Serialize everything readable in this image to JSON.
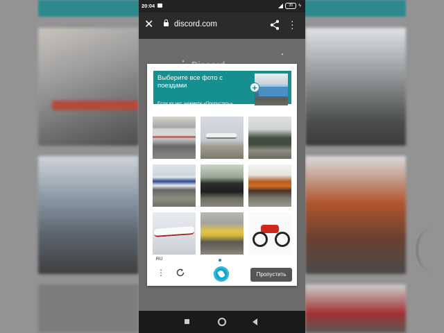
{
  "status_bar": {
    "time": "20:04",
    "battery": "35"
  },
  "browser": {
    "url": "discord.com"
  },
  "page": {
    "logo_text": "Discord"
  },
  "captcha": {
    "prompt_title": "Выберите все фото с поездами",
    "prompt_subtitle": "Если их нет, нажмите «Пропустить»",
    "accent_color": "#168f91",
    "tiles": [
      {
        "subject": "train"
      },
      {
        "subject": "airplane"
      },
      {
        "subject": "train"
      },
      {
        "subject": "train"
      },
      {
        "subject": "steam locomotive"
      },
      {
        "subject": "locomotive"
      },
      {
        "subject": "airplane"
      },
      {
        "subject": "locomotive"
      },
      {
        "subject": "motorcycle"
      }
    ],
    "language": "RU",
    "skip_label": "Пропустить"
  }
}
